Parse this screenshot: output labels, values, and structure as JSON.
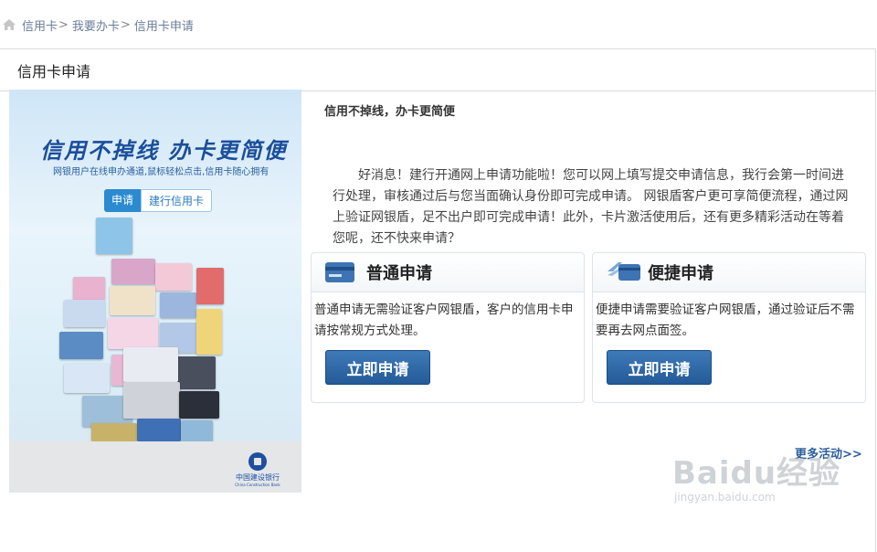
{
  "breadcrumb": {
    "items": [
      "信用卡",
      "我要办卡",
      "信用卡申请"
    ],
    "separator": ">"
  },
  "panel": {
    "title": "信用卡申请"
  },
  "banner": {
    "title": "信用不掉线  办卡更简便",
    "subtitle": "网银用户在线申办通道,鼠标轻松点击,信用卡随心拥有",
    "tag_primary": "申请",
    "tag_secondary": "建行信用卡",
    "bank_name_cn": "中国建设银行",
    "bank_name_en": "China Construction Bank"
  },
  "content": {
    "slogan": "信用不掉线，办卡更简便",
    "intro": "好消息！建行开通网上申请功能啦！您可以网上填写提交申请信息，我行会第一时间进行处理，审核通过后与您当面确认身份即可完成申请。 网银盾客户更可享简便流程，通过网上验证网银盾，足不出户即可完成申请！此外，卡片激活使用后，还有更多精彩活动在等着您呢，还不快来申请？"
  },
  "options": [
    {
      "title": "普通申请",
      "desc": "普通申请无需验证客户网银盾，客户的信用卡申请按常规方式处理。",
      "button": "立即申请",
      "icon": "card-icon"
    },
    {
      "title": "便捷申请",
      "desc": "便捷申请需要验证客户网银盾，通过验证后不需要再去网点面签。",
      "button": "立即申请",
      "icon": "fast-card-icon"
    }
  ],
  "more_link": "更多活动>>",
  "watermark": {
    "logo": "Baidu经验",
    "url": "jingyan.baidu.com"
  },
  "colors": {
    "accent": "#245a98",
    "link": "#2c5e9c",
    "banner_title": "#1b4e9b"
  }
}
